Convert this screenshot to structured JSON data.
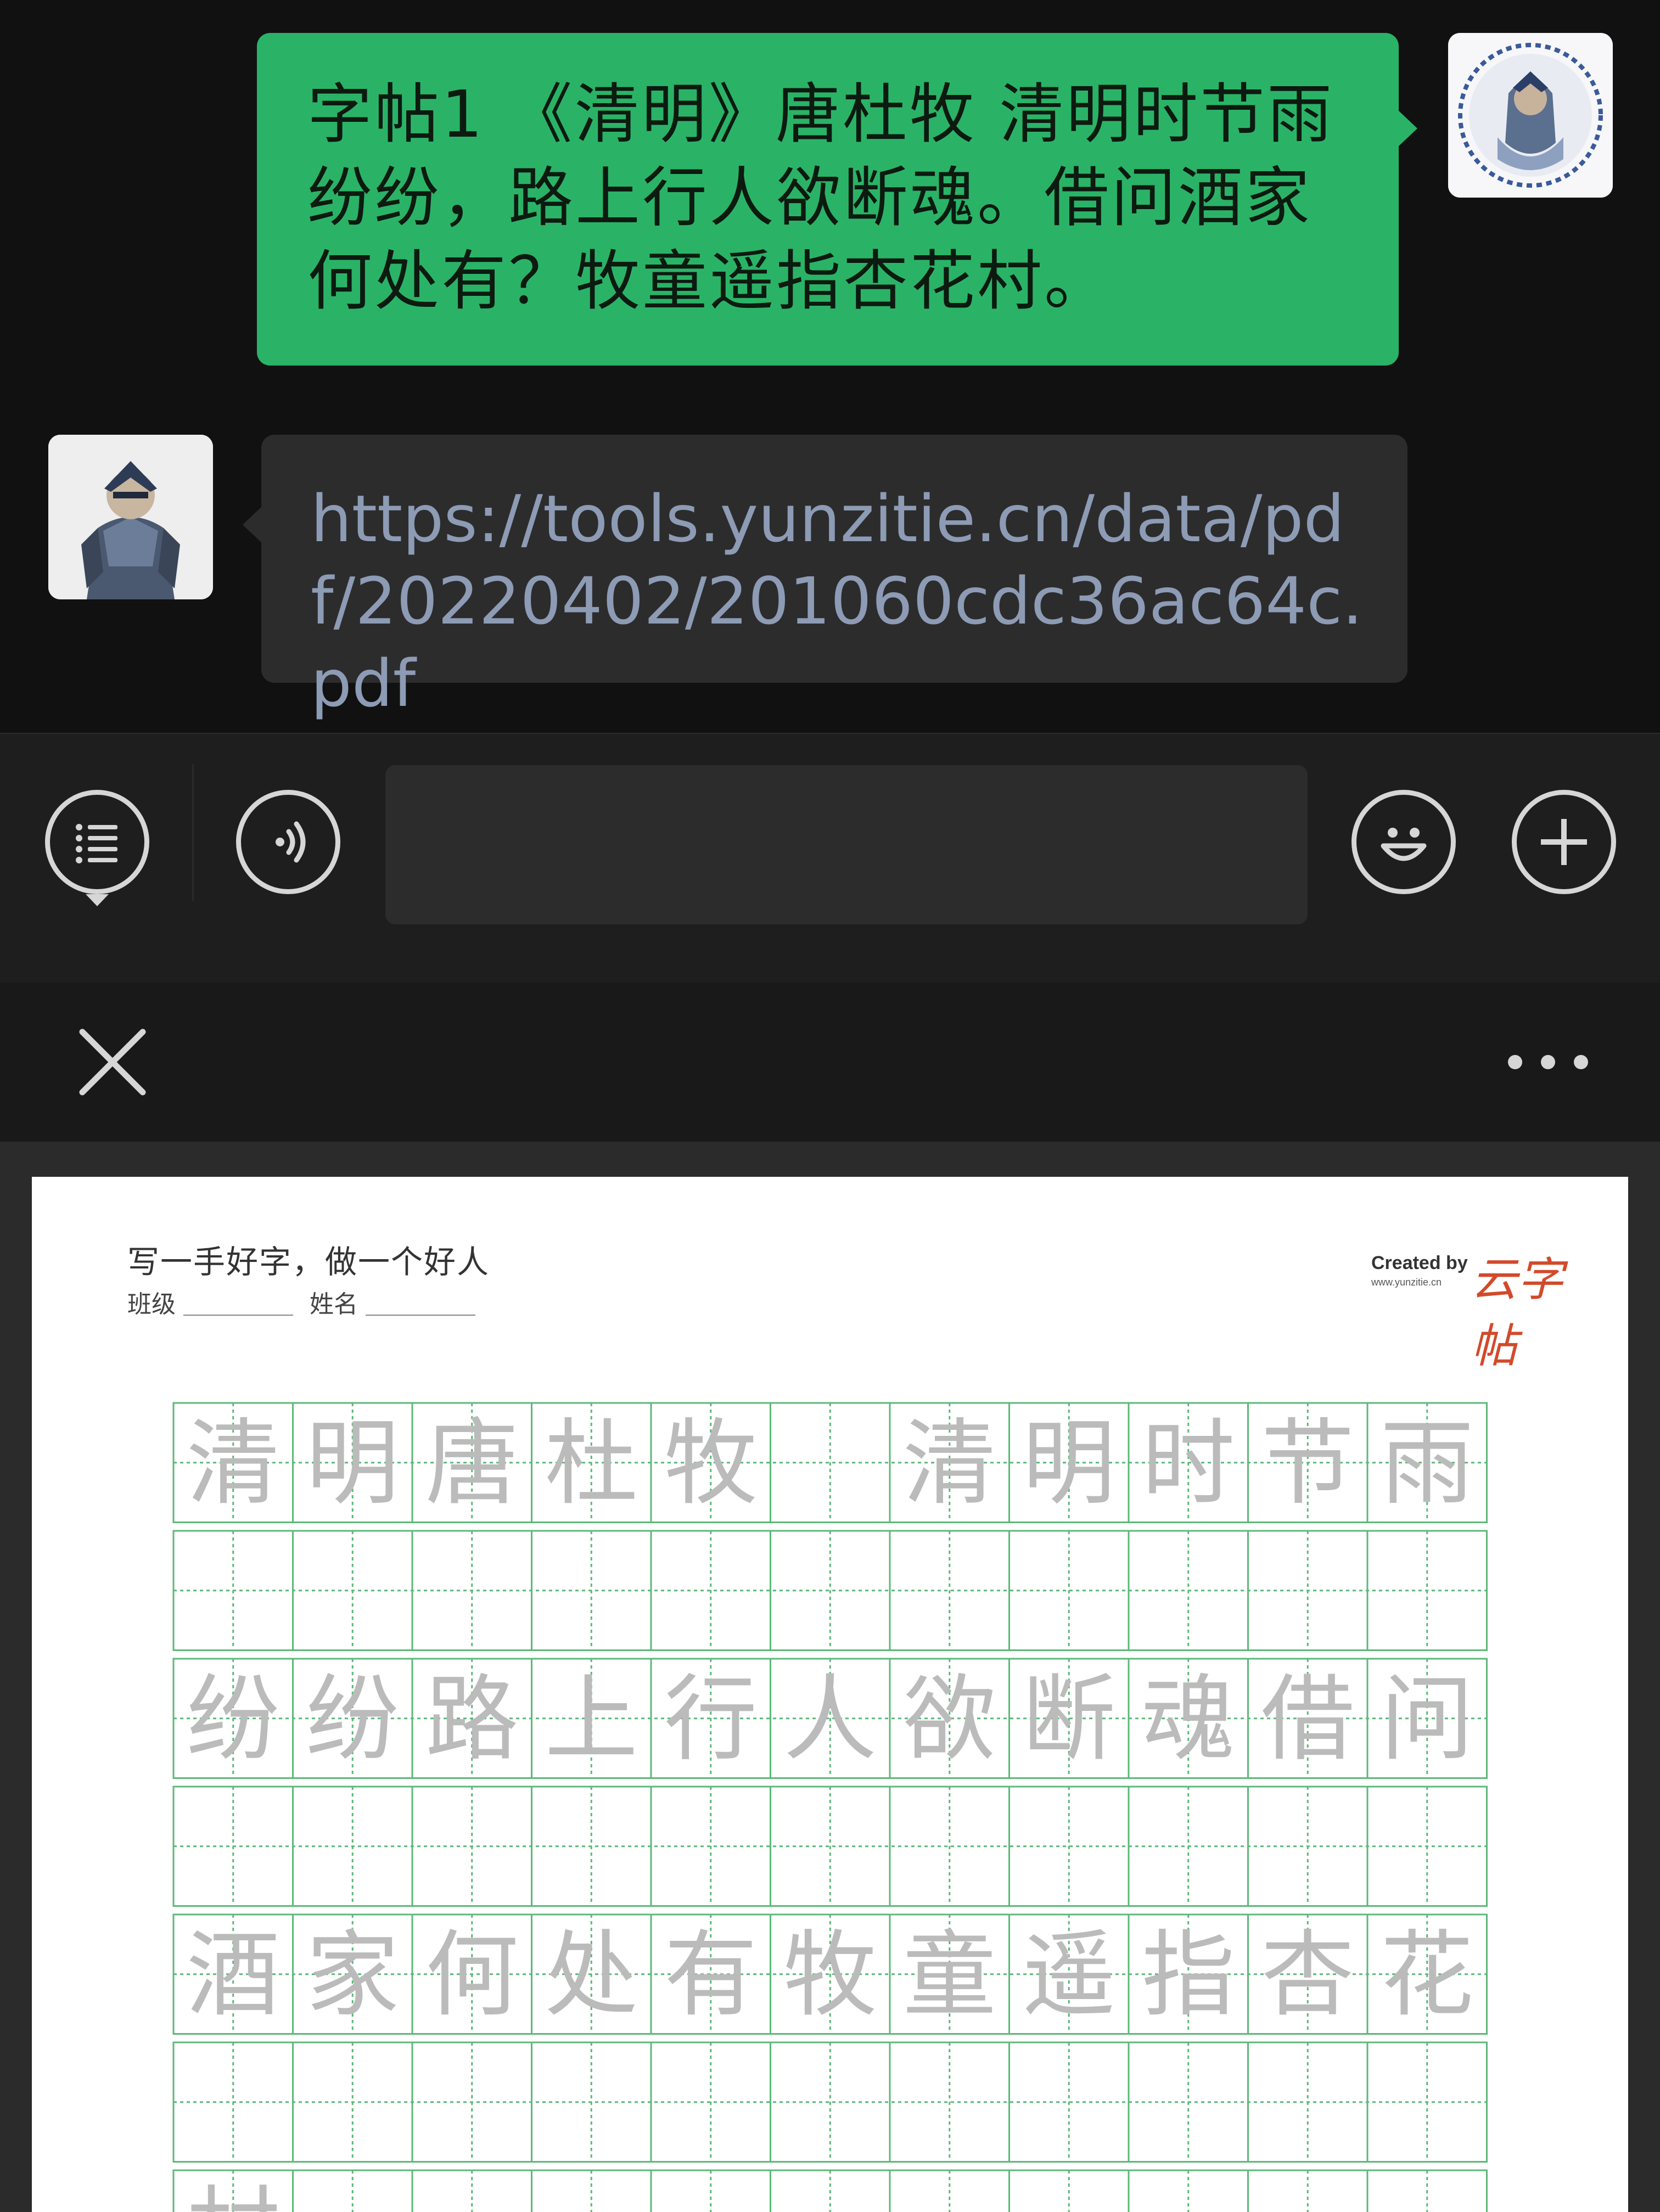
{
  "chat": {
    "outgoing_message": "字帖1 《清明》唐杜牧 清明时节雨纷纷，路上行人欲断魂。借问酒家何处有？牧童遥指杏花村。",
    "incoming_link": "https://tools.yunzitie.cn/data/pdf/20220402/201060cdc36ac64c.pdf"
  },
  "input_bar": {
    "left_icon": "list-menu-icon",
    "voice_icon": "voice-icon",
    "emoji_icon": "emoji-icon",
    "plus_icon": "plus-icon",
    "message_value": ""
  },
  "viewer": {
    "close_icon": "close-icon",
    "more_icon": "more-dots-icon"
  },
  "worksheet": {
    "motto": "写一手好字，做一个好人",
    "class_label": "班级",
    "name_label": "姓名",
    "created_by": "Created by",
    "site": "www.yunzitie.cn",
    "logo_text": "云字帖",
    "rows": [
      [
        "清",
        "明",
        "唐",
        "杜",
        "牧",
        "",
        "清",
        "明",
        "时",
        "节",
        "雨"
      ],
      [
        "",
        "",
        "",
        "",
        "",
        "",
        "",
        "",
        "",
        "",
        ""
      ],
      [
        "纷",
        "纷",
        "路",
        "上",
        "行",
        "人",
        "欲",
        "断",
        "魂",
        "借",
        "问"
      ],
      [
        "",
        "",
        "",
        "",
        "",
        "",
        "",
        "",
        "",
        "",
        ""
      ],
      [
        "酒",
        "家",
        "何",
        "处",
        "有",
        "牧",
        "童",
        "遥",
        "指",
        "杏",
        "花"
      ],
      [
        "",
        "",
        "",
        "",
        "",
        "",
        "",
        "",
        "",
        "",
        ""
      ],
      [
        "村",
        "",
        "",
        "",
        "",
        "",
        "",
        "",
        "",
        "",
        ""
      ]
    ],
    "grid_color": "#5cb878",
    "trace_color": "#bbbbbb"
  }
}
